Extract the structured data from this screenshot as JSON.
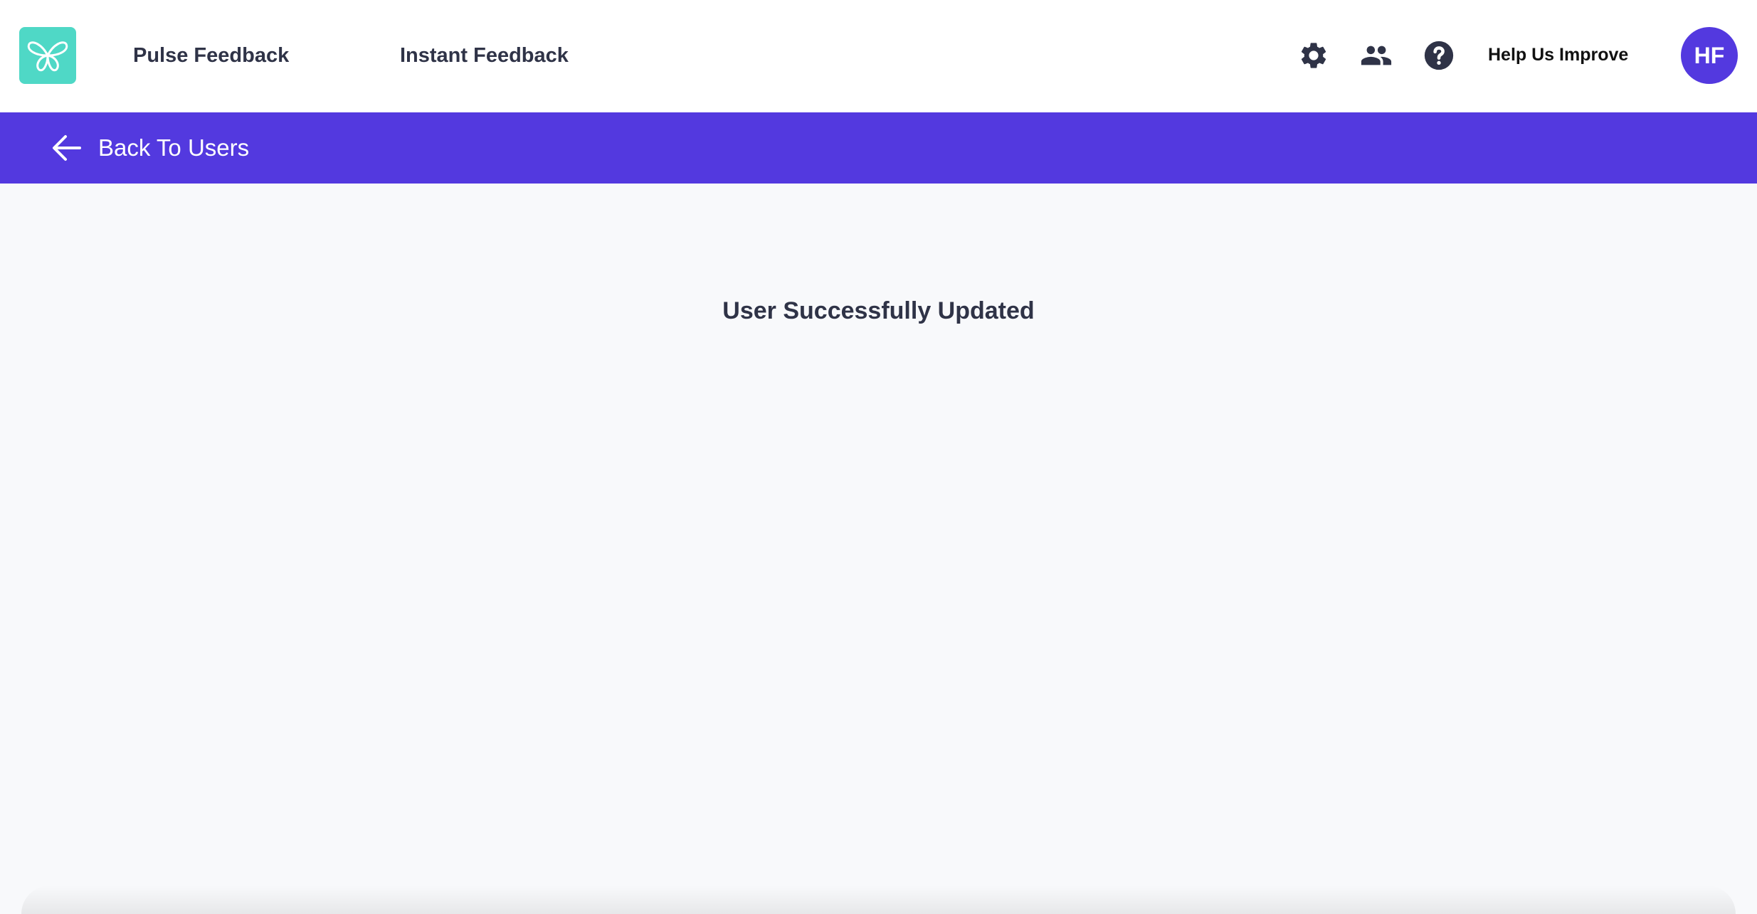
{
  "header": {
    "logo_icon": "butterfly-logo-icon",
    "nav": {
      "pulse_feedback": "Pulse Feedback",
      "instant_feedback": "Instant Feedback"
    },
    "icons": [
      "gear-icon",
      "users-icon",
      "help-icon"
    ],
    "help_us_improve": "Help Us Improve",
    "avatar_initials": "HF"
  },
  "backbar": {
    "back_label": "Back To Users",
    "icon": "arrow-left-icon"
  },
  "main": {
    "status_message": "User Successfully Updated"
  },
  "colors": {
    "brand_purple": "#5339df",
    "logo_teal": "#4fd8c6",
    "text_dark": "#2f3347",
    "background": "#f8f9fb"
  }
}
